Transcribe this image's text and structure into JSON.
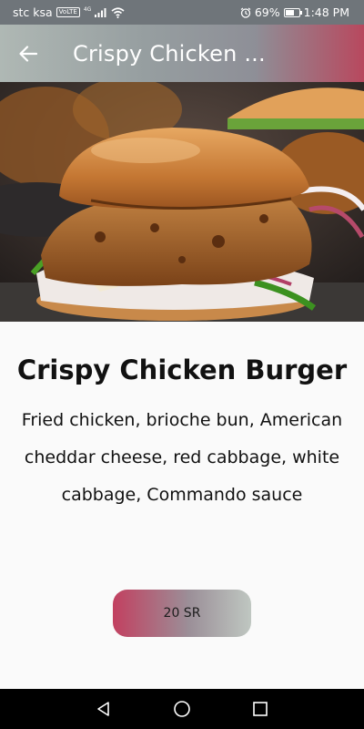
{
  "status_bar": {
    "carrier": "stc ksa",
    "volte": "VoLTE",
    "network": "4G",
    "battery_percent": "69%",
    "battery_level": 0.69,
    "time": "1:48 PM"
  },
  "app_bar": {
    "title": "Crispy Chicken ..."
  },
  "item": {
    "name": "Crispy Chicken Burger",
    "description": "Fried chicken, brioche bun, American cheddar cheese, red cabbage, white cabbage, Commando sauce",
    "price": "20 SR"
  },
  "colors": {
    "accent_red": "#c24060",
    "accent_gray": "#bfc7c1",
    "status_bar": "#6f757a",
    "nav_bar": "#000000"
  },
  "icons": {
    "back": "arrow-left-icon",
    "nav_back": "triangle-back-icon",
    "nav_home": "circle-home-icon",
    "nav_recents": "square-recents-icon"
  }
}
